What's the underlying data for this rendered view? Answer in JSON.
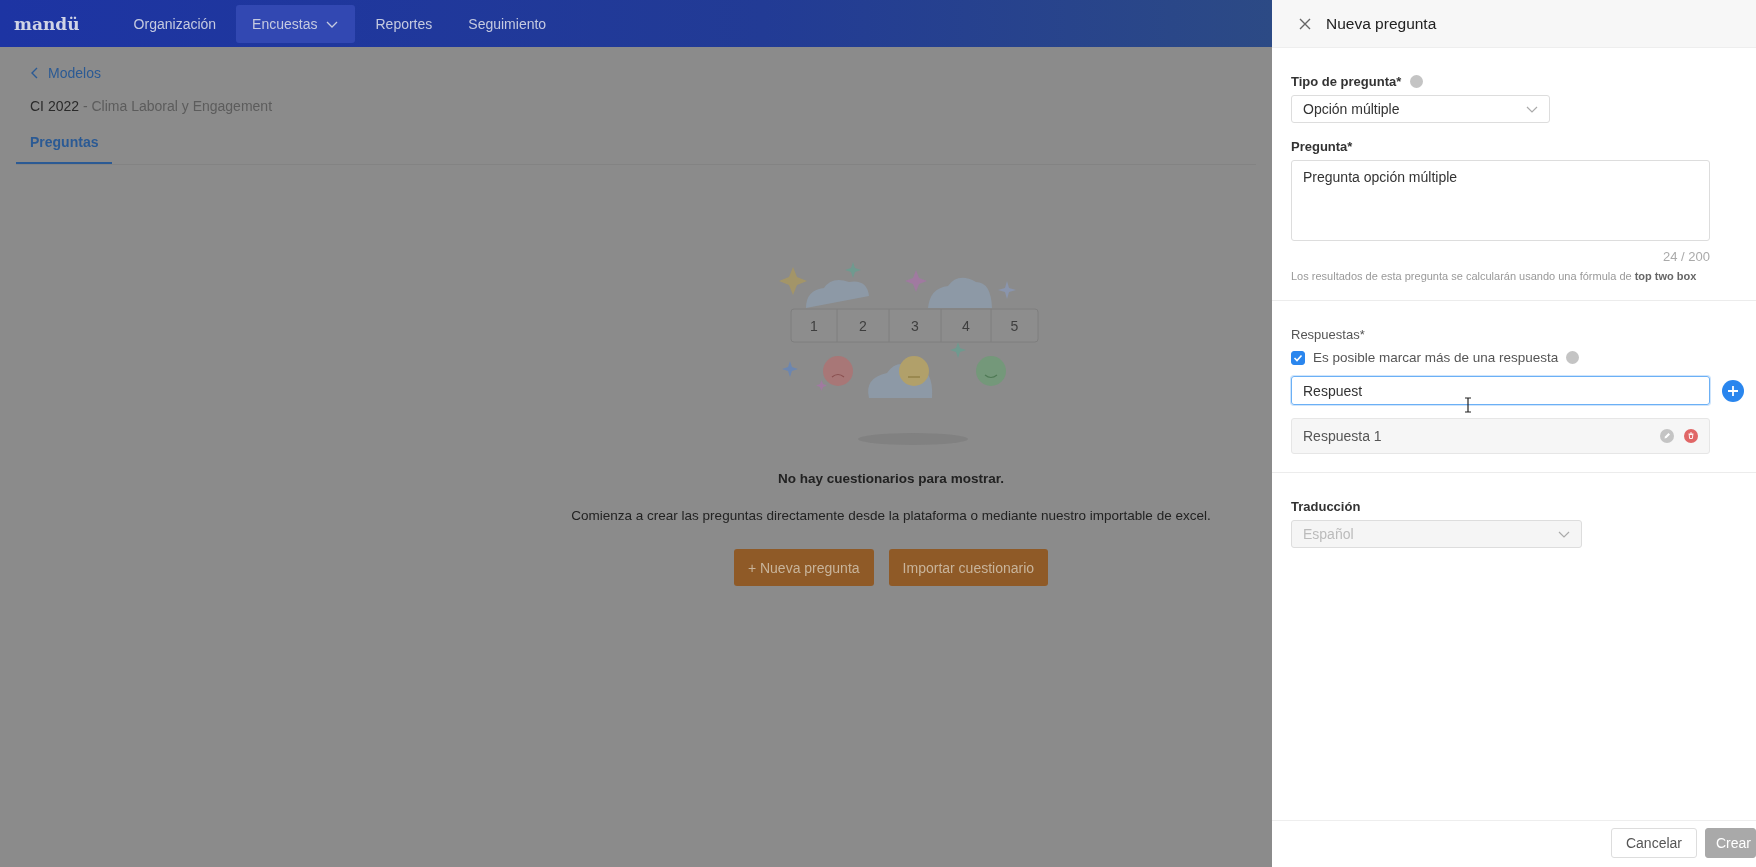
{
  "nav": {
    "logo": "mandü",
    "items": [
      {
        "label": "Organización",
        "selected": false,
        "dropdown": false
      },
      {
        "label": "Encuestas",
        "selected": true,
        "dropdown": true
      },
      {
        "label": "Reportes",
        "selected": false,
        "dropdown": false
      },
      {
        "label": "Seguimiento",
        "selected": false,
        "dropdown": false
      }
    ]
  },
  "page": {
    "back_link": "Modelos",
    "title_code": "CI 2022",
    "title_name": "- Clima Laboral y Engagement",
    "tabs": [
      {
        "label": "Preguntas",
        "selected": true
      }
    ],
    "empty_state": {
      "scale": [
        "1",
        "2",
        "3",
        "4",
        "5"
      ],
      "heading": "No hay cuestionarios para mostrar.",
      "description": "Comienza a crear las preguntas directamente desde la plataforma o mediante nuestro importable de excel.",
      "buttons": [
        {
          "label": "+ Nueva pregunta"
        },
        {
          "label": "Importar cuestionario"
        }
      ]
    }
  },
  "panel": {
    "title": "Nueva pregunta",
    "type_field": {
      "label": "Tipo de pregunta*",
      "value": "Opción múltiple"
    },
    "question_field": {
      "label": "Pregunta*",
      "value": "Pregunta opción múltiple",
      "counter": "24 / 200",
      "note": "Los resultados de esta pregunta se calcularán usando una fórmula de **top two box**"
    },
    "answers": {
      "label": "Respuestas*",
      "multiple": {
        "label": "Es posible marcar más de una respuesta",
        "checked": true
      },
      "input": {
        "value": "Respuest",
        "focused": true
      },
      "items": [
        {
          "text": "Respuesta 1"
        }
      ]
    },
    "translation": {
      "label": "Traducción",
      "value": "Español",
      "disabled": true
    },
    "footer_buttons": [
      {
        "label": "Cancelar",
        "disabled": false
      },
      {
        "label": "Crear",
        "disabled": true
      }
    ]
  }
}
